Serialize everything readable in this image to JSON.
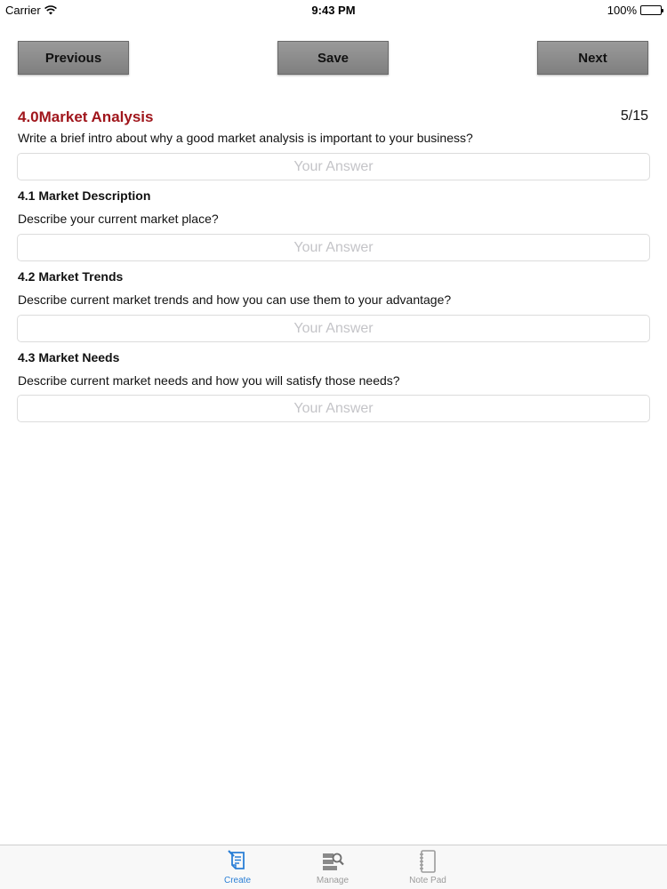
{
  "status_bar": {
    "carrier": "Carrier",
    "time": "9:43 PM",
    "battery": "100%"
  },
  "nav": {
    "previous_label": "Previous",
    "save_label": "Save",
    "next_label": "Next"
  },
  "section": {
    "number": "4.0",
    "title": "Market Analysis",
    "progress": "5/15",
    "intro_question": "Write a brief intro about why a good market analysis is important to your business?",
    "intro_answer": "",
    "intro_placeholder": "Your Answer"
  },
  "subsections": [
    {
      "title": "4.1 Market Description",
      "question": "Describe your current market place?",
      "answer": "",
      "placeholder": "Your Answer"
    },
    {
      "title": "4.2 Market Trends",
      "question": "Describe current market trends and how you can use them to your advantage?",
      "answer": "",
      "placeholder": "Your Answer"
    },
    {
      "title": "4.3 Market Needs",
      "question": "Describe current market needs and how you will satisfy those needs?",
      "answer": "",
      "placeholder": "Your Answer"
    }
  ],
  "tab_bar": {
    "tabs": [
      {
        "label": "Create",
        "icon": "create-document-icon",
        "active": true
      },
      {
        "label": "Manage",
        "icon": "manage-search-icon",
        "active": false
      },
      {
        "label": "Note Pad",
        "icon": "notepad-icon",
        "active": false
      }
    ],
    "active_color": "#2a7fd6",
    "inactive_color": "#9b9b9b"
  },
  "colors": {
    "section_title": "#a0161c",
    "button_bg": "#8c8c8c"
  }
}
